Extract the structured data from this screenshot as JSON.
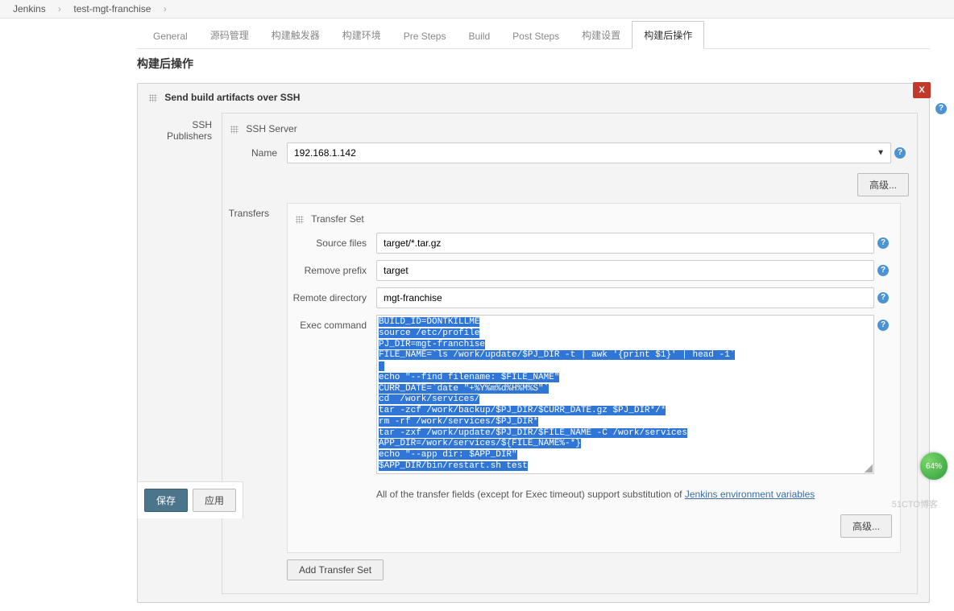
{
  "breadcrumb": {
    "root": "Jenkins",
    "job": "test-mgt-franchise"
  },
  "tabs": {
    "general": "General",
    "scm": "源码管理",
    "triggers": "构建触发器",
    "env": "构建环境",
    "pre": "Pre Steps",
    "build": "Build",
    "post": "Post Steps",
    "settings": "构建设置",
    "postbuild": "构建后操作"
  },
  "section": {
    "title": "构建后操作",
    "publisher_title": "Send build artifacts over SSH",
    "ssh_publishers_label": "SSH Publishers",
    "ssh_server_label": "SSH Server",
    "name_label": "Name",
    "server_name": "192.168.1.142",
    "advanced_btn": "高级...",
    "transfers_label": "Transfers",
    "transfer_set_label": "Transfer Set",
    "source_files_label": "Source files",
    "source_files": "target/*.tar.gz",
    "remove_prefix_label": "Remove prefix",
    "remove_prefix": "target",
    "remote_dir_label": "Remote directory",
    "remote_dir": "mgt-franchise",
    "exec_label": "Exec command",
    "exec_lines": [
      "BUILD_ID=DONTKILLME",
      "source /etc/profile",
      "PJ_DIR=mgt-franchise",
      "FILE_NAME=`ls /work/update/$PJ_DIR -t | awk '{print $1}' | head -1`",
      "",
      "echo \"--find filename: $FILE_NAME\"",
      "CURR_DATE=`date \"+%Y%m%d%H%M%S\"`",
      "cd  /work/services/",
      "tar -zcf /work/backup/$PJ_DIR/$CURR_DATE.gz $PJ_DIR*/*",
      "rm -rf /work/services/$PJ_DIR*",
      "tar -zxf /work/update/$PJ_DIR/$FILE_NAME -C /work/services",
      "APP_DIR=/work/services/${FILE_NAME%-*}",
      "echo \"--app dir: $APP_DIR\"",
      "$APP_DIR/bin/restart.sh test"
    ],
    "hint_prefix": "All of the transfer fields (except for Exec timeout) support substitution of ",
    "hint_link": "Jenkins environment variables",
    "add_transfer_btn": "Add Transfer Set",
    "close_label": "X"
  },
  "footer": {
    "save": "保存",
    "apply": "应用"
  },
  "badge": "64%",
  "watermark": "51CTO博客"
}
